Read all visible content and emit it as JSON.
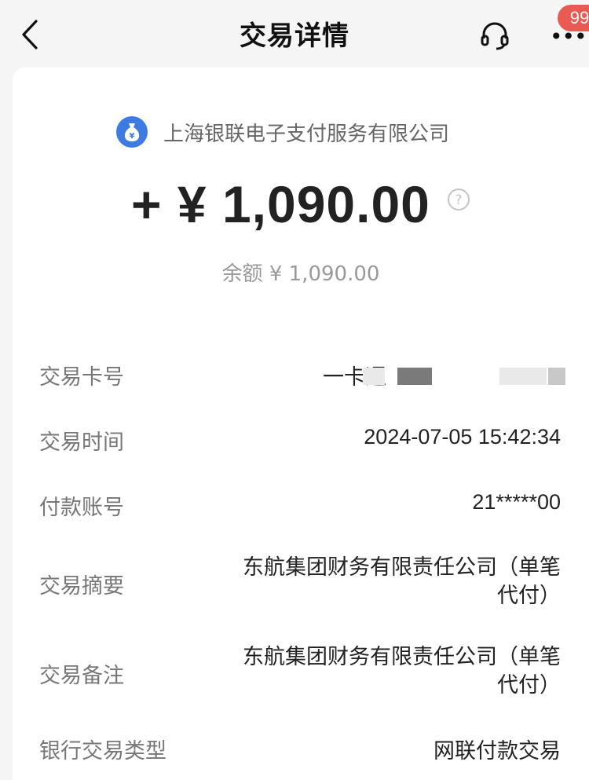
{
  "nav": {
    "title": "交易详情",
    "badge": "99"
  },
  "merchant": {
    "name": "上海银联电子支付服务有限公司",
    "icon": "money-bag-icon"
  },
  "transaction": {
    "amount": "+ ¥ 1,090.00",
    "balance": "余额 ¥ 1,090.00"
  },
  "details": [
    {
      "label": "交易卡号",
      "value": "一卡通"
    },
    {
      "label": "交易时间",
      "value": "2024-07-05 15:42:34"
    },
    {
      "label": "付款账号",
      "value": "21*****00"
    },
    {
      "label": "交易摘要",
      "value": "东航集团财务有限责任公司（单笔代付）"
    },
    {
      "label": "交易备注",
      "value": "东航集团财务有限责任公司（单笔代付）"
    },
    {
      "label": "银行交易类型",
      "value": "网联付款交易"
    }
  ],
  "colors": {
    "accent": "#3d7be0",
    "badge": "#e85a52"
  }
}
